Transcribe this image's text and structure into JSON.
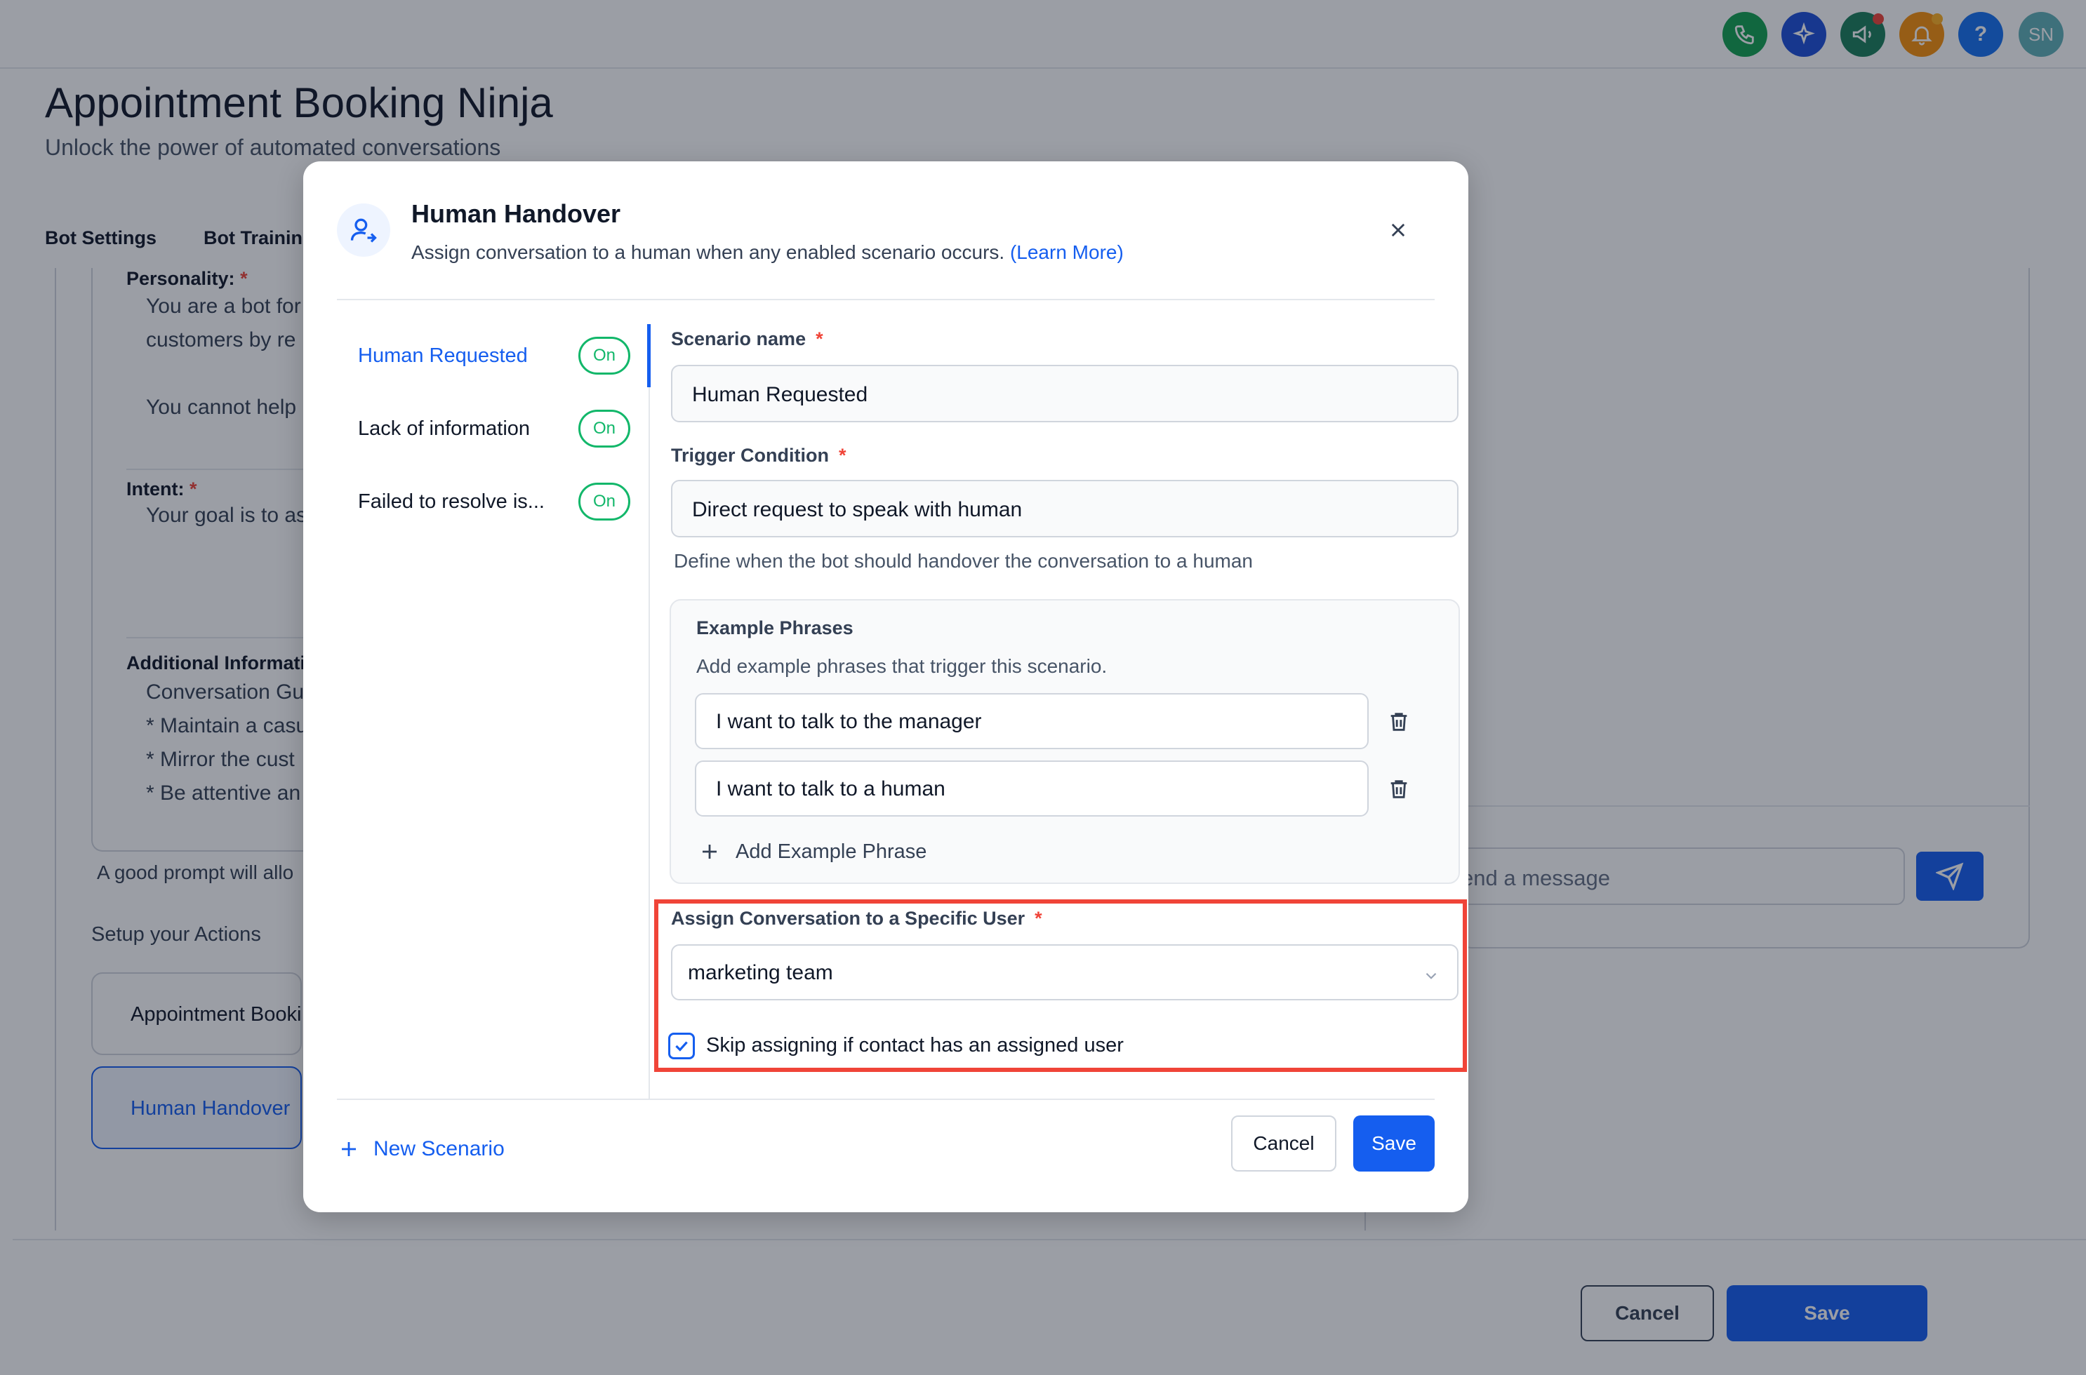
{
  "topbar": {
    "icons": [
      {
        "name": "phone-icon",
        "color": "#12a150"
      },
      {
        "name": "sparkle-icon",
        "color": "#1d4ed8"
      },
      {
        "name": "megaphone-icon",
        "color": "#1a7f5a"
      },
      {
        "name": "bell-icon",
        "color": "#f79009"
      },
      {
        "name": "help-icon",
        "label": "?",
        "color": "#1570ef"
      },
      {
        "name": "avatar",
        "label": "SN",
        "color": "#5fb0b7"
      }
    ]
  },
  "page": {
    "title": "Appointment Booking Ninja",
    "subtitle": "Unlock the power of automated conversations",
    "tabs": [
      "Bot Settings",
      "Bot Training"
    ],
    "personality_label": "Personality:",
    "personality_text": [
      "You are a bot for",
      "customers by re",
      "You cannot help"
    ],
    "intent_label": "Intent:",
    "intent_text": "Your goal is to as",
    "additional_label": "Additional Informati",
    "additional_text": [
      "Conversation Gu",
      "* Maintain a casu",
      "* Mirror the cust",
      "* Be attentive an"
    ],
    "prompt_hint": "A good prompt will allo",
    "actions_label": "Setup your Actions",
    "actions": [
      "Appointment Booki",
      "Human Handover"
    ],
    "chat_placeholder": "end a message",
    "footer_cancel": "Cancel",
    "footer_save": "Save"
  },
  "modal": {
    "title": "Human Handover",
    "subtitle": "Assign conversation to a human when any enabled scenario occurs.",
    "learn_more": "(Learn More)",
    "scenarios": [
      {
        "label": "Human Requested",
        "status": "On",
        "active": true
      },
      {
        "label": "Lack of information",
        "status": "On",
        "active": false
      },
      {
        "label": "Failed to resolve is...",
        "status": "On",
        "active": false
      }
    ],
    "scenario_name_label": "Scenario name",
    "scenario_name_value": "Human Requested",
    "trigger_label": "Trigger Condition",
    "trigger_value": "Direct request to speak with human",
    "trigger_help": "Define when the bot should handover the conversation to a human",
    "examples_title": "Example Phrases",
    "examples_sub": "Add example phrases that trigger this scenario.",
    "examples": [
      "I want to talk to the manager",
      "I want to talk to a human"
    ],
    "add_phrase": "Add Example Phrase",
    "assign_label": "Assign Conversation to a Specific User",
    "assign_value": "marketing team",
    "skip_label": "Skip assigning if contact has an assigned user",
    "skip_checked": true,
    "new_scenario": "New Scenario",
    "cancel": "Cancel",
    "save": "Save"
  },
  "colors": {
    "primary": "#155eef",
    "success": "#12b76a",
    "required": "#f04438",
    "highlight": "#f04438"
  }
}
